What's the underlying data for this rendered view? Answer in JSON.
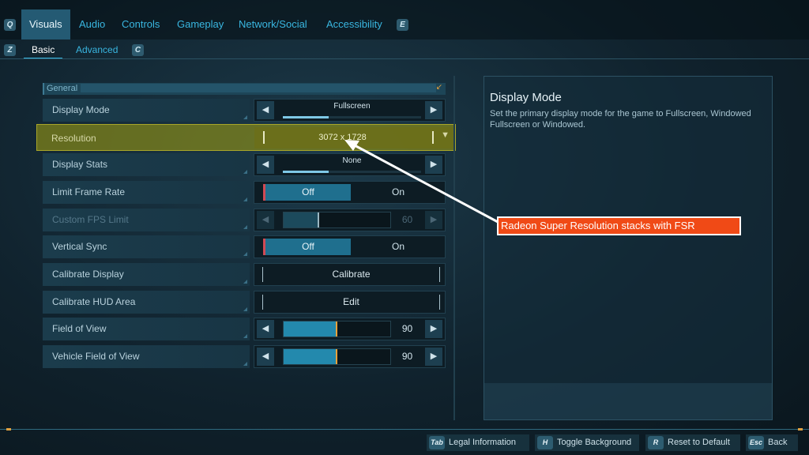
{
  "tabs": {
    "left_key": "Q",
    "right_key": "E",
    "items": [
      "Visuals",
      "Audio",
      "Controls",
      "Gameplay",
      "Network/Social",
      "Accessibility"
    ]
  },
  "subtabs": {
    "left_key": "Z",
    "right_key": "C",
    "items": [
      "Basic",
      "Advanced"
    ]
  },
  "section": {
    "label": "General"
  },
  "settings": {
    "display_mode": {
      "label": "Display Mode",
      "value": "Fullscreen",
      "progress": 0.33
    },
    "resolution": {
      "label": "Resolution",
      "value": "3072 x 1728"
    },
    "display_stats": {
      "label": "Display Stats",
      "value": "None",
      "progress": 0.33
    },
    "limit_frame_rate": {
      "label": "Limit Frame Rate",
      "off": "Off",
      "on": "On",
      "selected": "Off"
    },
    "custom_fps_limit": {
      "label": "Custom FPS Limit",
      "value": "60",
      "progress": 0.33
    },
    "vertical_sync": {
      "label": "Vertical Sync",
      "off": "Off",
      "on": "On",
      "selected": "Off"
    },
    "calibrate_display": {
      "label": "Calibrate Display",
      "button": "Calibrate"
    },
    "calibrate_hud": {
      "label": "Calibrate HUD Area",
      "button": "Edit"
    },
    "fov": {
      "label": "Field of View",
      "value": "90",
      "progress": 0.5
    },
    "vehicle_fov": {
      "label": "Vehicle Field of View",
      "value": "90",
      "progress": 0.5
    }
  },
  "description": {
    "title": "Display Mode",
    "text": "Set the primary display mode for the game to Fullscreen, Windowed Fullscreen or Windowed."
  },
  "annotation": {
    "text": "Radeon Super Resolution stacks with FSR"
  },
  "footer": [
    {
      "key": "Tab",
      "label": "Legal Information"
    },
    {
      "key": "H",
      "label": "Toggle Background"
    },
    {
      "key": "R",
      "label": "Reset to Default"
    },
    {
      "key": "Esc",
      "label": "Back"
    }
  ],
  "colors": {
    "accent": "#39b6e0",
    "highlight": "#96961a",
    "callout": "#f04a16",
    "slider": "#2389ad"
  },
  "icons": {
    "left": "chevron-left-icon",
    "right": "chevron-right-icon",
    "dropdown": "chevron-down-icon"
  }
}
